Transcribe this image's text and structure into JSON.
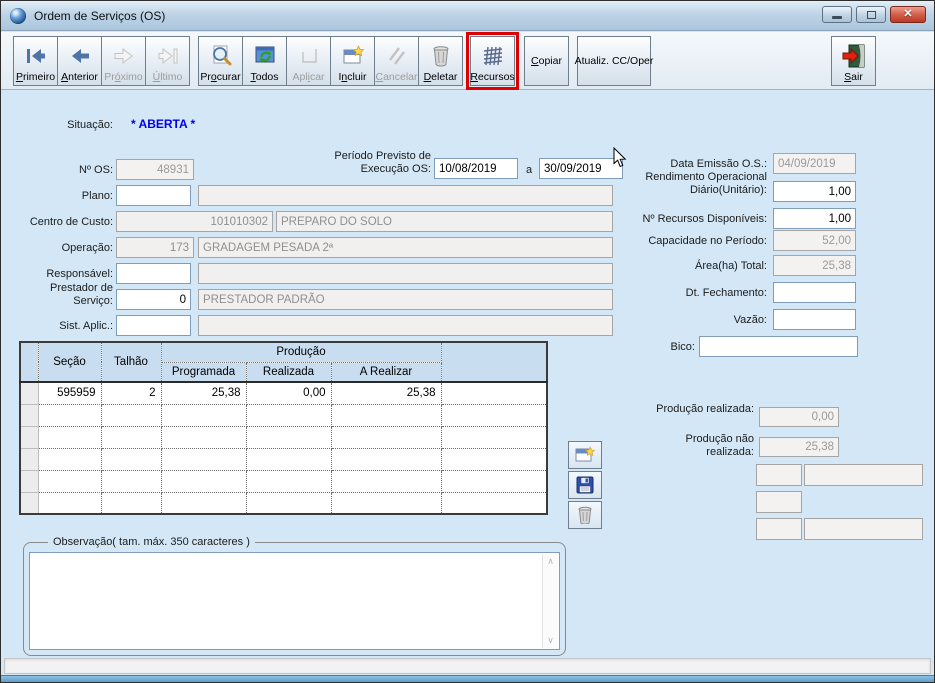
{
  "window": {
    "title": "Ordem de Serviços (OS)"
  },
  "toolbar": {
    "buttons": [
      {
        "label": "Primeiro",
        "icon": "first-icon",
        "enabled": true,
        "mnemonic": 0
      },
      {
        "label": "Anterior",
        "icon": "previous-icon",
        "enabled": true,
        "mnemonic": 0
      },
      {
        "label": "Próximo",
        "icon": "next-icon",
        "enabled": false,
        "mnemonic": 2
      },
      {
        "label": "Último",
        "icon": "last-icon",
        "enabled": false,
        "mnemonic": 0
      },
      {
        "label": "Procurar",
        "icon": "search-icon",
        "enabled": true,
        "mnemonic": 2,
        "gap": true
      },
      {
        "label": "Todos",
        "icon": "refresh-icon",
        "enabled": true,
        "mnemonic": 0
      },
      {
        "label": "Aplicar",
        "icon": "apply-icon",
        "enabled": false,
        "mnemonic": 3
      },
      {
        "label": "Incluir",
        "icon": "new-icon",
        "enabled": true,
        "mnemonic": 1
      },
      {
        "label": "Cancelar",
        "icon": "cancel-icon",
        "enabled": false,
        "mnemonic": 0
      },
      {
        "label": "Deletar",
        "icon": "trash-icon",
        "enabled": true,
        "mnemonic": 0
      },
      {
        "label": "Recursos",
        "icon": "grid-icon",
        "enabled": true,
        "mnemonic": 0,
        "highlighted": true
      },
      {
        "label": "Copiar",
        "icon": null,
        "enabled": true,
        "mnemonic": 0,
        "gap": true
      },
      {
        "label": "Atualiz. CC/Oper",
        "icon": null,
        "enabled": true,
        "mnemonic": -1,
        "wide": true,
        "gap": true
      }
    ],
    "exit_button": {
      "label": "Sair",
      "icon": "exit-icon",
      "mnemonic": 0
    }
  },
  "situacao": {
    "label": "Situação:",
    "value": "* ABERTA *"
  },
  "form_left": {
    "nos": {
      "label": "Nº OS:",
      "value": "48931"
    },
    "periodo": {
      "label": "Período Previsto de Execução OS:",
      "from": "10/08/2019",
      "sep": "a",
      "to": "30/09/2019"
    },
    "plano": {
      "label": "Plano:",
      "value": "",
      "desc": ""
    },
    "centro_custo": {
      "label": "Centro de Custo:",
      "value": "101010302",
      "desc": "PREPARO DO SOLO"
    },
    "operacao": {
      "label": "Operação:",
      "value": "173",
      "desc": "GRADAGEM PESADA 2ª"
    },
    "responsavel": {
      "label": "Responsável:",
      "value": "",
      "desc": ""
    },
    "prestador": {
      "label": "Prestador de Serviço:",
      "value": "0",
      "desc": "PRESTADOR PADRÃO"
    },
    "sist_aplic": {
      "label": "Sist. Aplic.:",
      "value": "",
      "desc": ""
    }
  },
  "form_right": {
    "data_emissao": {
      "label": "Data Emissão O.S.:",
      "value": "04/09/2019"
    },
    "rendimento": {
      "label": "Rendimento Operacional Diário(Unitário):",
      "value": "1,00"
    },
    "recursos_disp": {
      "label": "Nº Recursos Disponíveis:",
      "value": "1,00"
    },
    "capacidade": {
      "label": "Capacidade no Período:",
      "value": "52,00"
    },
    "area_total": {
      "label": "Área(ha) Total:",
      "value": "25,38"
    },
    "dt_fechamento": {
      "label": "Dt. Fechamento:",
      "value": ""
    },
    "vazao": {
      "label": "Vazão:",
      "value": ""
    },
    "bico": {
      "label": "Bico:",
      "value": ""
    },
    "prod_realizada": {
      "label": "Produção realizada:",
      "value": "0,00"
    },
    "prod_nao_realizada": {
      "label": "Produção não realizada:",
      "value": "25,38"
    }
  },
  "table": {
    "headers": {
      "secao": "Seção",
      "talhao": "Talhão",
      "producao": "Produção",
      "programada": "Programada",
      "realizada": "Realizada",
      "a_realizar": "A Realizar"
    },
    "rows": [
      [
        "595959",
        "2",
        "25,38",
        "0,00",
        "25,38",
        ""
      ]
    ],
    "empty_row_count": 5
  },
  "observacao": {
    "group_label": "Observação( tam. máx. 350 caracteres )",
    "value": ""
  },
  "colors": {
    "highlight_red": "#dd0000",
    "situacao_blue": "#0000ee",
    "table_header_blue": "#c9ddf0",
    "client_bg": "#d3e7f6"
  }
}
